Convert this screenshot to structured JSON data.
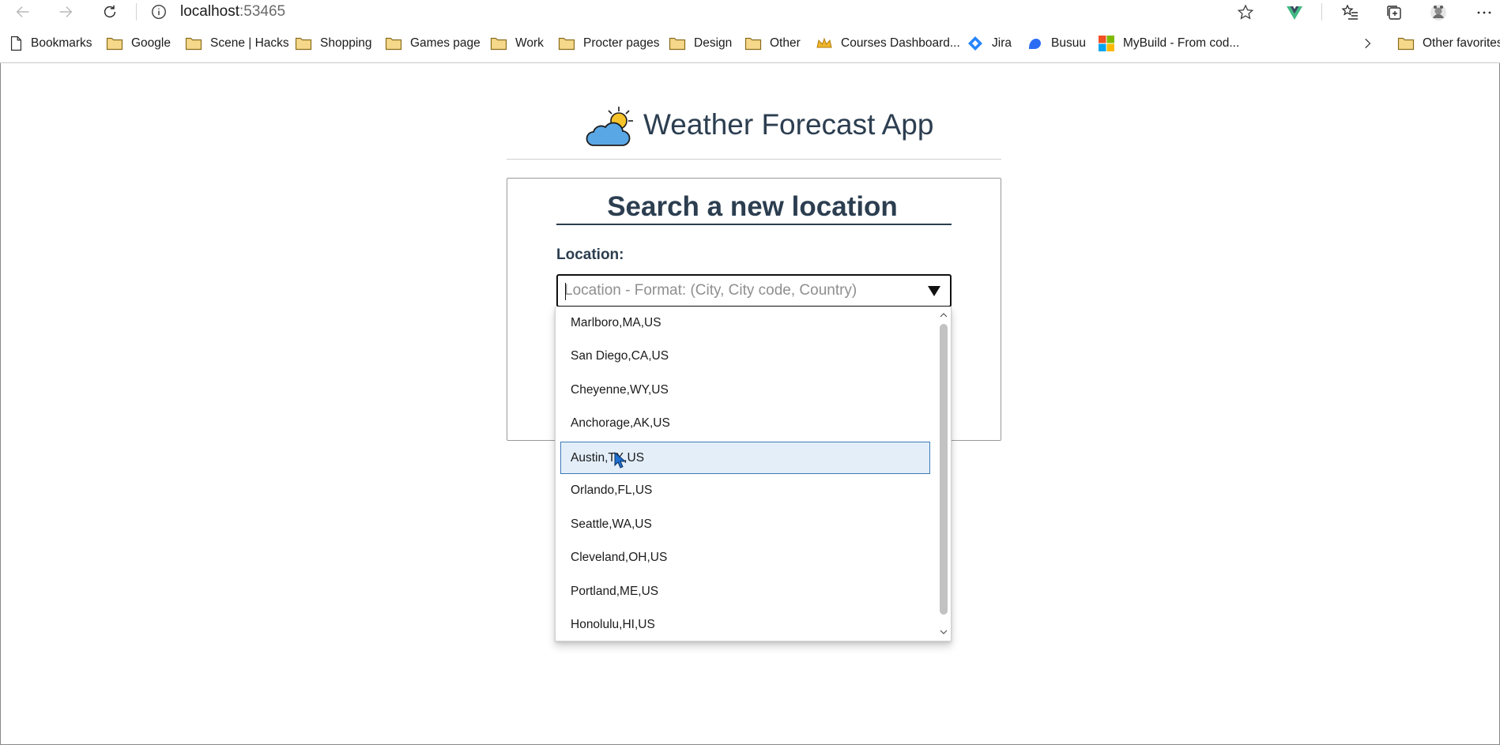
{
  "browser": {
    "url_host": "localhost",
    "url_port": ":53465",
    "bookmarks": [
      {
        "label": "Bookmarks",
        "icon": "page-icon"
      },
      {
        "label": "Google",
        "icon": "folder-icon"
      },
      {
        "label": "Scene | Hacks",
        "icon": "folder-icon"
      },
      {
        "label": "Shopping",
        "icon": "folder-icon"
      },
      {
        "label": "Games page",
        "icon": "folder-icon"
      },
      {
        "label": "Work",
        "icon": "folder-icon"
      },
      {
        "label": "Procter pages",
        "icon": "folder-icon"
      },
      {
        "label": "Design",
        "icon": "folder-icon"
      },
      {
        "label": "Other",
        "icon": "folder-icon"
      },
      {
        "label": "Courses Dashboard...",
        "icon": "crown-icon"
      },
      {
        "label": "Jira",
        "icon": "jira-icon"
      },
      {
        "label": "Busuu",
        "icon": "busuu-icon"
      },
      {
        "label": "MyBuild - From cod...",
        "icon": "microsoft-icon"
      }
    ],
    "other_favorites": "Other favorites"
  },
  "app": {
    "title": "Weather Forecast App",
    "search": {
      "heading": "Search a new location",
      "label": "Location:",
      "placeholder": "Location - Format: (City, City code, Country)",
      "value": ""
    },
    "suggestions": [
      "Marlboro,MA,US",
      "San Diego,CA,US",
      "Cheyenne,WY,US",
      "Anchorage,AK,US",
      "Austin,TX,US",
      "Orlando,FL,US",
      "Seattle,WA,US",
      "Cleveland,OH,US",
      "Portland,ME,US",
      "Honolulu,HI,US"
    ],
    "highlighted_suggestion": "Austin,TX,US"
  },
  "colors": {
    "heading": "#2c3e50",
    "highlight_bg": "#e3eef9",
    "highlight_border": "#3f79b8"
  }
}
